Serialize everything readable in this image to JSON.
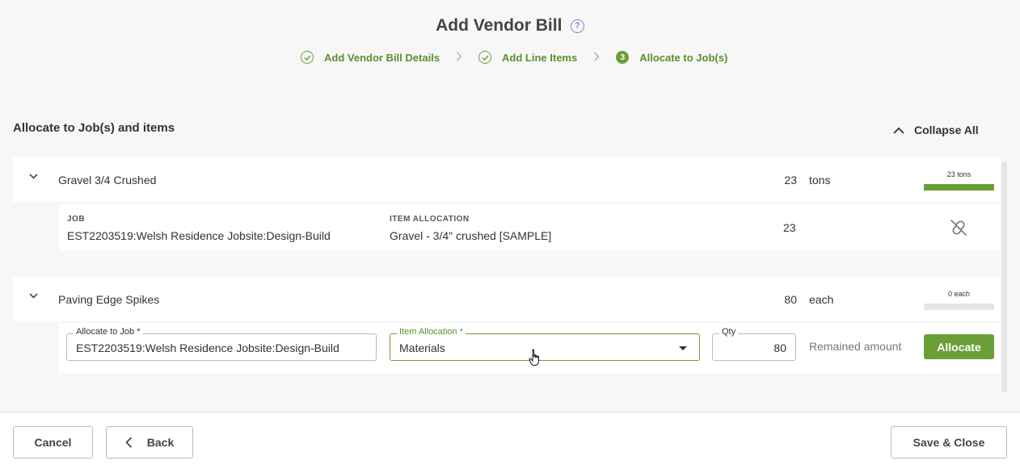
{
  "header": {
    "title": "Add Vendor Bill",
    "help_icon": "question-circle-icon",
    "steps": [
      {
        "label": "Add Vendor Bill Details",
        "state": "done"
      },
      {
        "label": "Add Line Items",
        "state": "done"
      },
      {
        "label": "Allocate to Job(s)",
        "state": "active",
        "number": "3"
      }
    ]
  },
  "section": {
    "title": "Allocate to Job(s) and items",
    "collapse_all": "Collapse All"
  },
  "items": [
    {
      "name": "Gravel 3/4 Crushed",
      "qty": "23",
      "unit": "tons",
      "progress_label": "23 tons",
      "progress_fraction": 1.0,
      "allocation": {
        "job_label": "JOB",
        "job_value": "EST2203519:Welsh Residence Jobsite:Design-Build",
        "item_label": "ITEM ALLOCATION",
        "item_value": "Gravel - 3/4\" crushed [SAMPLE]",
        "qty": "23"
      }
    },
    {
      "name": "Paving Edge Spikes",
      "qty": "80",
      "unit": "each",
      "progress_label": "0 each",
      "progress_fraction": 0.0,
      "form": {
        "job_label": "Allocate to Job *",
        "job_value": "EST2203519:Welsh Residence Jobsite:Design-Build",
        "item_label": "Item Allocation *",
        "item_value": "Materials",
        "qty_label": "Qty",
        "qty_value": "80",
        "remained": "Remained amount",
        "allocate": "Allocate"
      }
    }
  ],
  "footer": {
    "cancel": "Cancel",
    "back": "Back",
    "save_close": "Save & Close"
  },
  "colors": {
    "accent": "#6a9f38",
    "accent_text": "#5b8f2e",
    "help": "#8a85d8"
  }
}
